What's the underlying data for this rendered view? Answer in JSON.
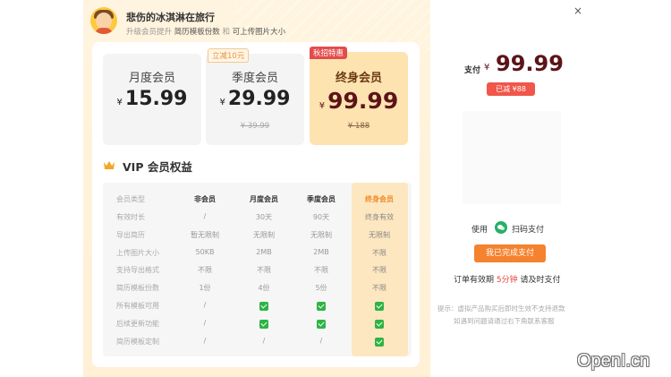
{
  "user": {
    "name": "悲伤的冰淇淋在旅行",
    "tip_prefix": "升级会员提升",
    "tip_item1": "简历模板份数",
    "tip_and": "和",
    "tip_item2": "可上传图片大小"
  },
  "plans": [
    {
      "name": "月度会员",
      "currency": "¥",
      "price": "15.99",
      "original": ""
    },
    {
      "name": "季度会员",
      "currency": "¥",
      "price": "29.99",
      "original": "¥ 39.99",
      "tag": "立减10元"
    },
    {
      "name": "终身会员",
      "currency": "¥",
      "price": "99.99",
      "original": "¥ 188",
      "tag": "秋招特惠"
    }
  ],
  "benefits": {
    "title": "VIP 会员权益",
    "headers": [
      "会员类型",
      "非会员",
      "月度会员",
      "季度会员",
      "终身会员"
    ],
    "rows": [
      {
        "label": "有效时长",
        "cells": [
          "/",
          "30天",
          "90天",
          "终身有效"
        ]
      },
      {
        "label": "导出简历",
        "cells": [
          "暂无限制",
          "无限制",
          "无限制",
          "无限制"
        ]
      },
      {
        "label": "上传图片大小",
        "cells": [
          "50KB",
          "2MB",
          "2MB",
          "不限"
        ]
      },
      {
        "label": "支持导出格式",
        "cells": [
          "不限",
          "不限",
          "不限",
          "不限"
        ]
      },
      {
        "label": "简历模板份数",
        "cells": [
          "1份",
          "4份",
          "5份",
          "不限"
        ]
      },
      {
        "label": "所有模板可用",
        "cells": [
          "/",
          "check",
          "check",
          "check"
        ]
      },
      {
        "label": "后续更新功能",
        "cells": [
          "/",
          "check",
          "check",
          "check"
        ]
      },
      {
        "label": "简历模板定制",
        "cells": [
          "/",
          "/",
          "/",
          "check"
        ]
      }
    ]
  },
  "payment": {
    "close_glyph": "×",
    "label": "支付",
    "currency": "¥",
    "amount": "99.99",
    "reduced": "已减 ¥88",
    "use_label": "使用",
    "method": "扫码支付",
    "done_button": "我已完成支付",
    "expire_prefix": "订单有效期",
    "expire_time": "5分钟",
    "expire_suffix": "请及时支付",
    "tip1": "提示：虚拟产品购买后即时生效不支持退款",
    "tip2": "如遇到问题请通过右下角联系客服"
  },
  "watermark": "OpenI.cn",
  "colors": {
    "accent_orange": "#f5822e",
    "price_dark": "#5c1418",
    "check_green": "#2fb344",
    "wechat_green": "#2aae67"
  }
}
